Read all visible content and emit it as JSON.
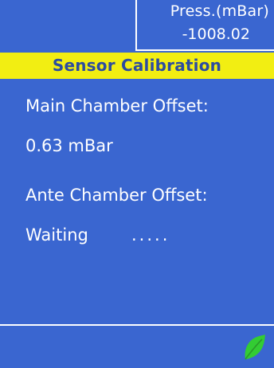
{
  "header": {
    "pressure_label": "Press.(mBar)",
    "pressure_value": "-1008.02"
  },
  "title": "Sensor Calibration",
  "main_chamber": {
    "label": "Main Chamber Offset:",
    "value": "0.63 mBar"
  },
  "ante_chamber": {
    "label": "Ante Chamber Offset:",
    "status": "Waiting",
    "progress_dots": "....."
  },
  "footer": {
    "icon": "leaf-icon"
  },
  "colors": {
    "background": "#3A66D0",
    "title_bar": "#F2EE12",
    "title_text": "#2C4CA0",
    "text": "#FFFFFF",
    "leaf": "#33CC33"
  }
}
